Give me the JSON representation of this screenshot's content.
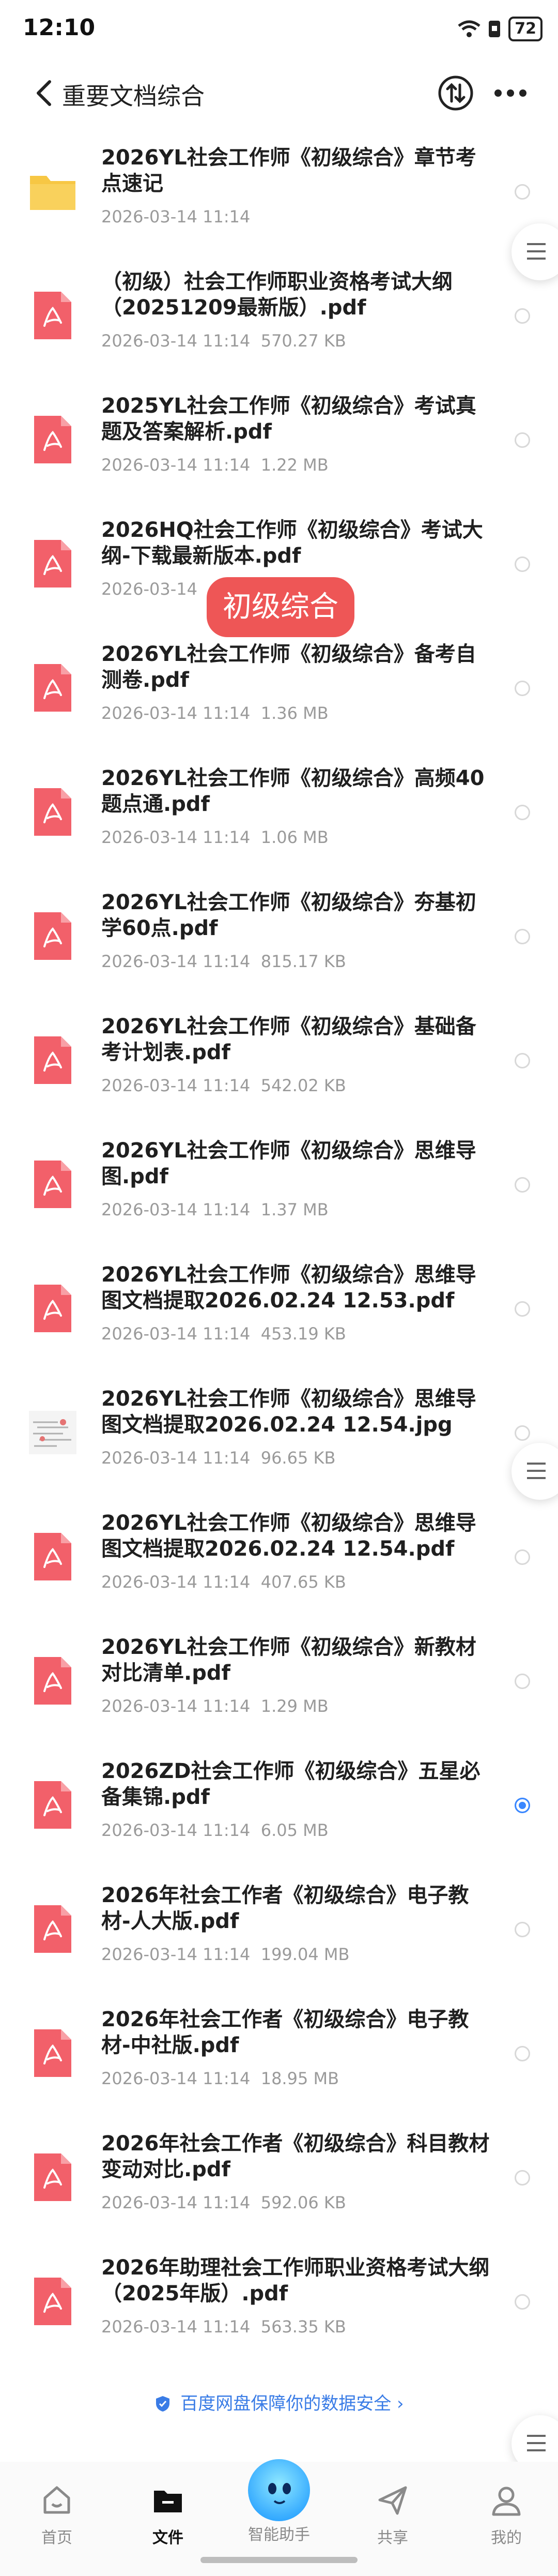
{
  "status": {
    "time": "12:10",
    "battery": "72"
  },
  "header": {
    "title": "重要文档综合"
  },
  "overlay_label": "初级综合",
  "files": [
    {
      "name": "2026YL社会工作师《初级综合》章节考点速记",
      "meta": "2026-03-14 11:14",
      "type": "folder",
      "selected": false
    },
    {
      "name": "（初级）社会工作师职业资格考试大纲（20251209最新版）.pdf",
      "meta": "2026-03-14 11:14  570.27 KB",
      "type": "pdf",
      "selected": false
    },
    {
      "name": "2025YL社会工作师《初级综合》考试真题及答案解析.pdf",
      "meta": "2026-03-14 11:14  1.22 MB",
      "type": "pdf",
      "selected": false
    },
    {
      "name": "2026HQ社会工作师《初级综合》考试大纲-下载最新版本.pdf",
      "meta": "2026-03-14",
      "type": "pdf",
      "selected": false
    },
    {
      "name": "2026YL社会工作师《初级综合》备考自测卷.pdf",
      "meta": "2026-03-14 11:14  1.36 MB",
      "type": "pdf",
      "selected": false
    },
    {
      "name": "2026YL社会工作师《初级综合》高频40题点通.pdf",
      "meta": "2026-03-14 11:14  1.06 MB",
      "type": "pdf",
      "selected": false
    },
    {
      "name": "2026YL社会工作师《初级综合》夯基初学60点.pdf",
      "meta": "2026-03-14 11:14  815.17 KB",
      "type": "pdf",
      "selected": false
    },
    {
      "name": "2026YL社会工作师《初级综合》基础备考计划表.pdf",
      "meta": "2026-03-14 11:14  542.02 KB",
      "type": "pdf",
      "selected": false
    },
    {
      "name": "2026YL社会工作师《初级综合》思维导图.pdf",
      "meta": "2026-03-14 11:14  1.37 MB",
      "type": "pdf",
      "selected": false
    },
    {
      "name": "2026YL社会工作师《初级综合》思维导图文档提取2026.02.24 12.53.pdf",
      "meta": "2026-03-14 11:14  453.19 KB",
      "type": "pdf",
      "selected": false
    },
    {
      "name": "2026YL社会工作师《初级综合》思维导图文档提取2026.02.24 12.54.jpg",
      "meta": "2026-03-14 11:14  96.65 KB",
      "type": "image",
      "selected": false
    },
    {
      "name": "2026YL社会工作师《初级综合》思维导图文档提取2026.02.24 12.54.pdf",
      "meta": "2026-03-14 11:14  407.65 KB",
      "type": "pdf",
      "selected": false
    },
    {
      "name": "2026YL社会工作师《初级综合》新教材对比清单.pdf",
      "meta": "2026-03-14 11:14  1.29 MB",
      "type": "pdf",
      "selected": false
    },
    {
      "name": "2026ZD社会工作师《初级综合》五星必备集锦.pdf",
      "meta": "2026-03-14 11:14  6.05 MB",
      "type": "pdf",
      "selected": true
    },
    {
      "name": "2026年社会工作者《初级综合》电子教材-人大版.pdf",
      "meta": "2026-03-14 11:14  199.04 MB",
      "type": "pdf",
      "selected": false
    },
    {
      "name": "2026年社会工作者《初级综合》电子教材-中社版.pdf",
      "meta": "2026-03-14 11:14  18.95 MB",
      "type": "pdf",
      "selected": false
    },
    {
      "name": "2026年社会工作者《初级综合》科目教材变动对比.pdf",
      "meta": "2026-03-14 11:14  592.06 KB",
      "type": "pdf",
      "selected": false
    },
    {
      "name": "2026年助理社会工作师职业资格考试大纲（2025年版）.pdf",
      "meta": "2026-03-14 11:14  563.35 KB",
      "type": "pdf",
      "selected": false
    }
  ],
  "footer_note": "百度网盘保障你的数据安全 ›",
  "nav": {
    "home": "首页",
    "files": "文件",
    "assistant": "智能助手",
    "share": "共享",
    "mine": "我的"
  },
  "colors": {
    "pdf_red": "#f2606a",
    "folder_yellow": "#f7c744",
    "accent_blue": "#3a87ff"
  }
}
